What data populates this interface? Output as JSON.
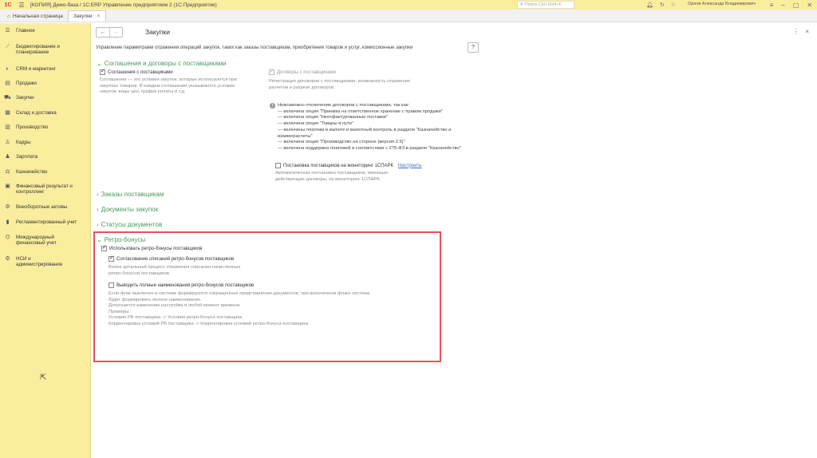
{
  "titlebar": {
    "logo": "1С",
    "title": "[КОПИЯ] Демо-база / 1С:ERP Управление предприятием 2  (1С:Предприятие)",
    "search_placeholder": "Поиск Ctrl+Shift+F",
    "user": "Орлов Александр Владимирович"
  },
  "tabs": [
    {
      "label": "Начальная страница"
    },
    {
      "label": "Закупки"
    }
  ],
  "sidebar": {
    "items": [
      {
        "label": "Главное",
        "icon": "menu-lines-icon"
      },
      {
        "label": "Бюджетирование и планирование",
        "icon": "chart-icon"
      },
      {
        "label": "CRM и маркетинг",
        "icon": "crm-icon"
      },
      {
        "label": "Продажи",
        "icon": "sales-icon"
      },
      {
        "label": "Закупки",
        "icon": "cart-icon"
      },
      {
        "label": "Склад и доставка",
        "icon": "warehouse-icon"
      },
      {
        "label": "Производство",
        "icon": "factory-icon"
      },
      {
        "label": "Кадры",
        "icon": "person-icon"
      },
      {
        "label": "Зарплата",
        "icon": "salary-icon"
      },
      {
        "label": "Казначейство",
        "icon": "treasury-icon"
      },
      {
        "label": "Финансовый результат и контроллинг",
        "icon": "finance-icon"
      },
      {
        "label": "Внеоборотные активы",
        "icon": "assets-icon"
      },
      {
        "label": "Регламентированный учет",
        "icon": "book-icon"
      },
      {
        "label": "Международный финансовый учет",
        "icon": "globe-icon"
      },
      {
        "label": "НСИ и администрирование",
        "icon": "gear-icon"
      }
    ]
  },
  "form": {
    "title": "Закупки",
    "description": "Управление параметрами отражения операций закупок, таких как заказы поставщикам, приобретения товаров и услуг, комиссионные закупки",
    "help": "?",
    "sections": {
      "agreements": "Соглашения и договоры с поставщиками",
      "orders": "Заказы поставщикам",
      "documents": "Документы закупок",
      "statuses": "Статусы документов",
      "retro": "Ретро-бонусы"
    },
    "agreements": {
      "cb_agreements": "Соглашения с поставщиками",
      "agreements_note": [
        "Соглашения — это условия закупок, которые используются при",
        "закупках товаров. В каждом соглашении указываются условия",
        "закупок: виды цен, график оплаты и т.д."
      ],
      "cb_contracts": "Договоры с поставщиками",
      "contracts_note": [
        "Регистрация договоров с поставщиками, возможность отражения",
        "расчетов в разрезе договоров."
      ],
      "warning": [
        "Невозможно отключение договоров с поставщиками, так как:",
        "— включена опция \"Приемка на ответственное хранение с правом продажи\"",
        "— включена опция \"Неотфактурованные поставки\"",
        "— включена опция \"Товары в пути\"",
        "— включены платежи в валюте и валютный контроль в разделе \"Казначейство и",
        "взаиморасчеты\"",
        "— включена опция \"Производство на стороне (версия 2.5)\"",
        "— включена поддержка платежей в соответствии с 275-ФЗ в разделе \"Казначейство\""
      ],
      "cb_monitoring": "Постановка поставщиков на мониторинг 1СПАРК",
      "monitoring_link": "Настроить",
      "monitoring_note": [
        "Автоматическая постановка поставщиков, имеющих",
        "действующие договоры, на мониторинг 1СПАРК."
      ]
    },
    "retro": {
      "cb_use": "Использовать ретро-бонусы поставщиков",
      "cb_approval": "Согласование списаний ретро-бонусов поставщиков",
      "approval_note": [
        "Более детальный процесс отражения списания начисленных",
        "ретро-бонусов поставщиков."
      ],
      "cb_full_names": "Выводить полные наименования ретро-бонусов поставщиков",
      "full_names_note": [
        "Если флаг выключен в системе формируются сокращенные представления документов, при включенном флаге система",
        "будет формировать полное наименование.",
        "Допускается изменение настройки в любой момент времени.",
        "Примеры:",
        "Условия РБ поставщика -> Условия ретро-бонуса поставщика",
        "Корректировка условий РБ поставщика -> Корректировка условий ретро-бонуса поставщика"
      ]
    }
  },
  "colors": {
    "sidebar_bg": "#fbed9e",
    "section_green": "#4a9a5a",
    "highlight_red": "#e8505b",
    "link_blue": "#3a6fb5"
  }
}
